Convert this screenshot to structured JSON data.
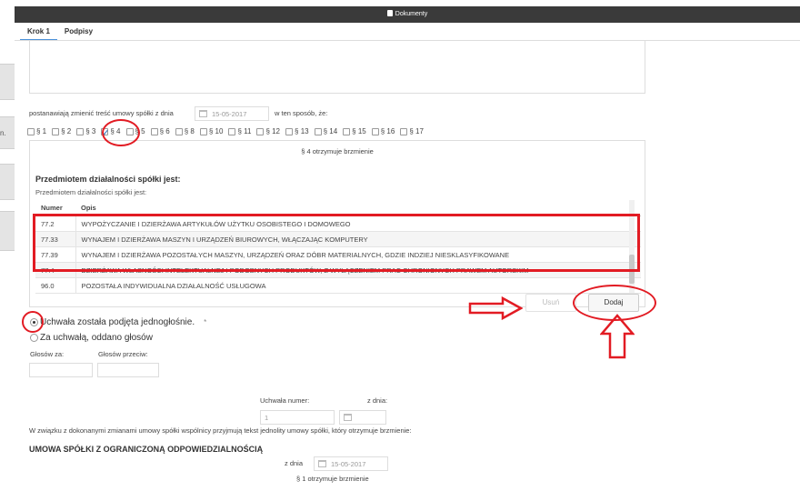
{
  "window": {
    "title": "Dokumenty"
  },
  "tabs": [
    {
      "label": "Krok 1"
    },
    {
      "label": "Podpisy"
    }
  ],
  "left_panel": {
    "fragment": "n."
  },
  "intro": {
    "text_before": "postanawiają zmienić treść umowy spółki z dnia",
    "date": "15-05-2017",
    "text_after": "w ten sposób, że:"
  },
  "paragraphs": [
    {
      "label": "§ 1",
      "checked": false
    },
    {
      "label": "§ 2",
      "checked": false
    },
    {
      "label": "§ 3",
      "checked": false
    },
    {
      "label": "§ 4",
      "checked": true
    },
    {
      "label": "§ 5",
      "checked": false
    },
    {
      "label": "§ 6",
      "checked": false
    },
    {
      "label": "§ 8",
      "checked": false
    },
    {
      "label": "§ 10",
      "checked": false
    },
    {
      "label": "§ 11",
      "checked": false
    },
    {
      "label": "§ 12",
      "checked": false
    },
    {
      "label": "§ 13",
      "checked": false
    },
    {
      "label": "§ 14",
      "checked": false
    },
    {
      "label": "§ 15",
      "checked": false
    },
    {
      "label": "§ 16",
      "checked": false
    },
    {
      "label": "§ 17",
      "checked": false
    }
  ],
  "panel": {
    "heading": "§ 4 otrzymuje brzmienie",
    "section_title": "Przedmiotem działalności spółki jest:",
    "section_sub": "Przedmiotem działalności spółki jest:",
    "columns": {
      "num": "Numer",
      "desc": "Opis"
    },
    "rows": [
      {
        "num": "77.2",
        "desc": "WYPOŻYCZANIE I DZIERŻAWA ARTYKUŁÓW UŻYTKU OSOBISTEGO I DOMOWEGO"
      },
      {
        "num": "77.33",
        "desc": "WYNAJEM I DZIERŻAWA MASZYN I URZĄDZEŃ BIUROWYCH, WŁĄCZAJĄC KOMPUTERY"
      },
      {
        "num": "77.39",
        "desc": "WYNAJEM I DZIERŻAWA POZOSTAŁYCH MASZYN, URZĄDZEŃ ORAZ DÓBR MATERIALNYCH, GDZIE INDZIEJ NIESKLASYFIKOWANE"
      },
      {
        "num": "77.4",
        "desc": "DZIERŻAWA WŁASNOŚCI INTELEKTUALNEJ I PODOBNYCH PRODUKTÓW, Z WYŁĄCZENIEM PRAC CHRONIONYCH PRAWEM AUTORSKIM"
      },
      {
        "num": "96.0",
        "desc": "POZOSTAŁA INDYWIDUALNA DZIAŁALNOŚĆ USŁUGOWA"
      }
    ]
  },
  "buttons": {
    "remove": "Usuń",
    "add": "Dodaj"
  },
  "resolution": {
    "unanimous": "Uchwała została podjęta jednogłośnie.",
    "asterisk": "*",
    "votes_option": "Za uchwałą, oddano głosów",
    "votes_for": "Głosów za:",
    "votes_against": "Głosów przeciw:",
    "number_label": "Uchwała numer:",
    "number_value": "1",
    "date_label": "z dnia:"
  },
  "consolidated_text": "W związku z dokonanymi zmianami umowy spółki wspólnicy przyjmują tekst jednolity umowy spółki, który otrzymuje brzmienie:",
  "contract": {
    "title": "UMOWA SPÓŁKI Z OGRANICZONĄ ODPOWIEDZIALNOŚCIĄ",
    "date_label": "z dnia",
    "date": "15-05-2017",
    "para_heading": "§ 1 otrzymuje brzmienie"
  },
  "annotation_color": "#e21b23"
}
